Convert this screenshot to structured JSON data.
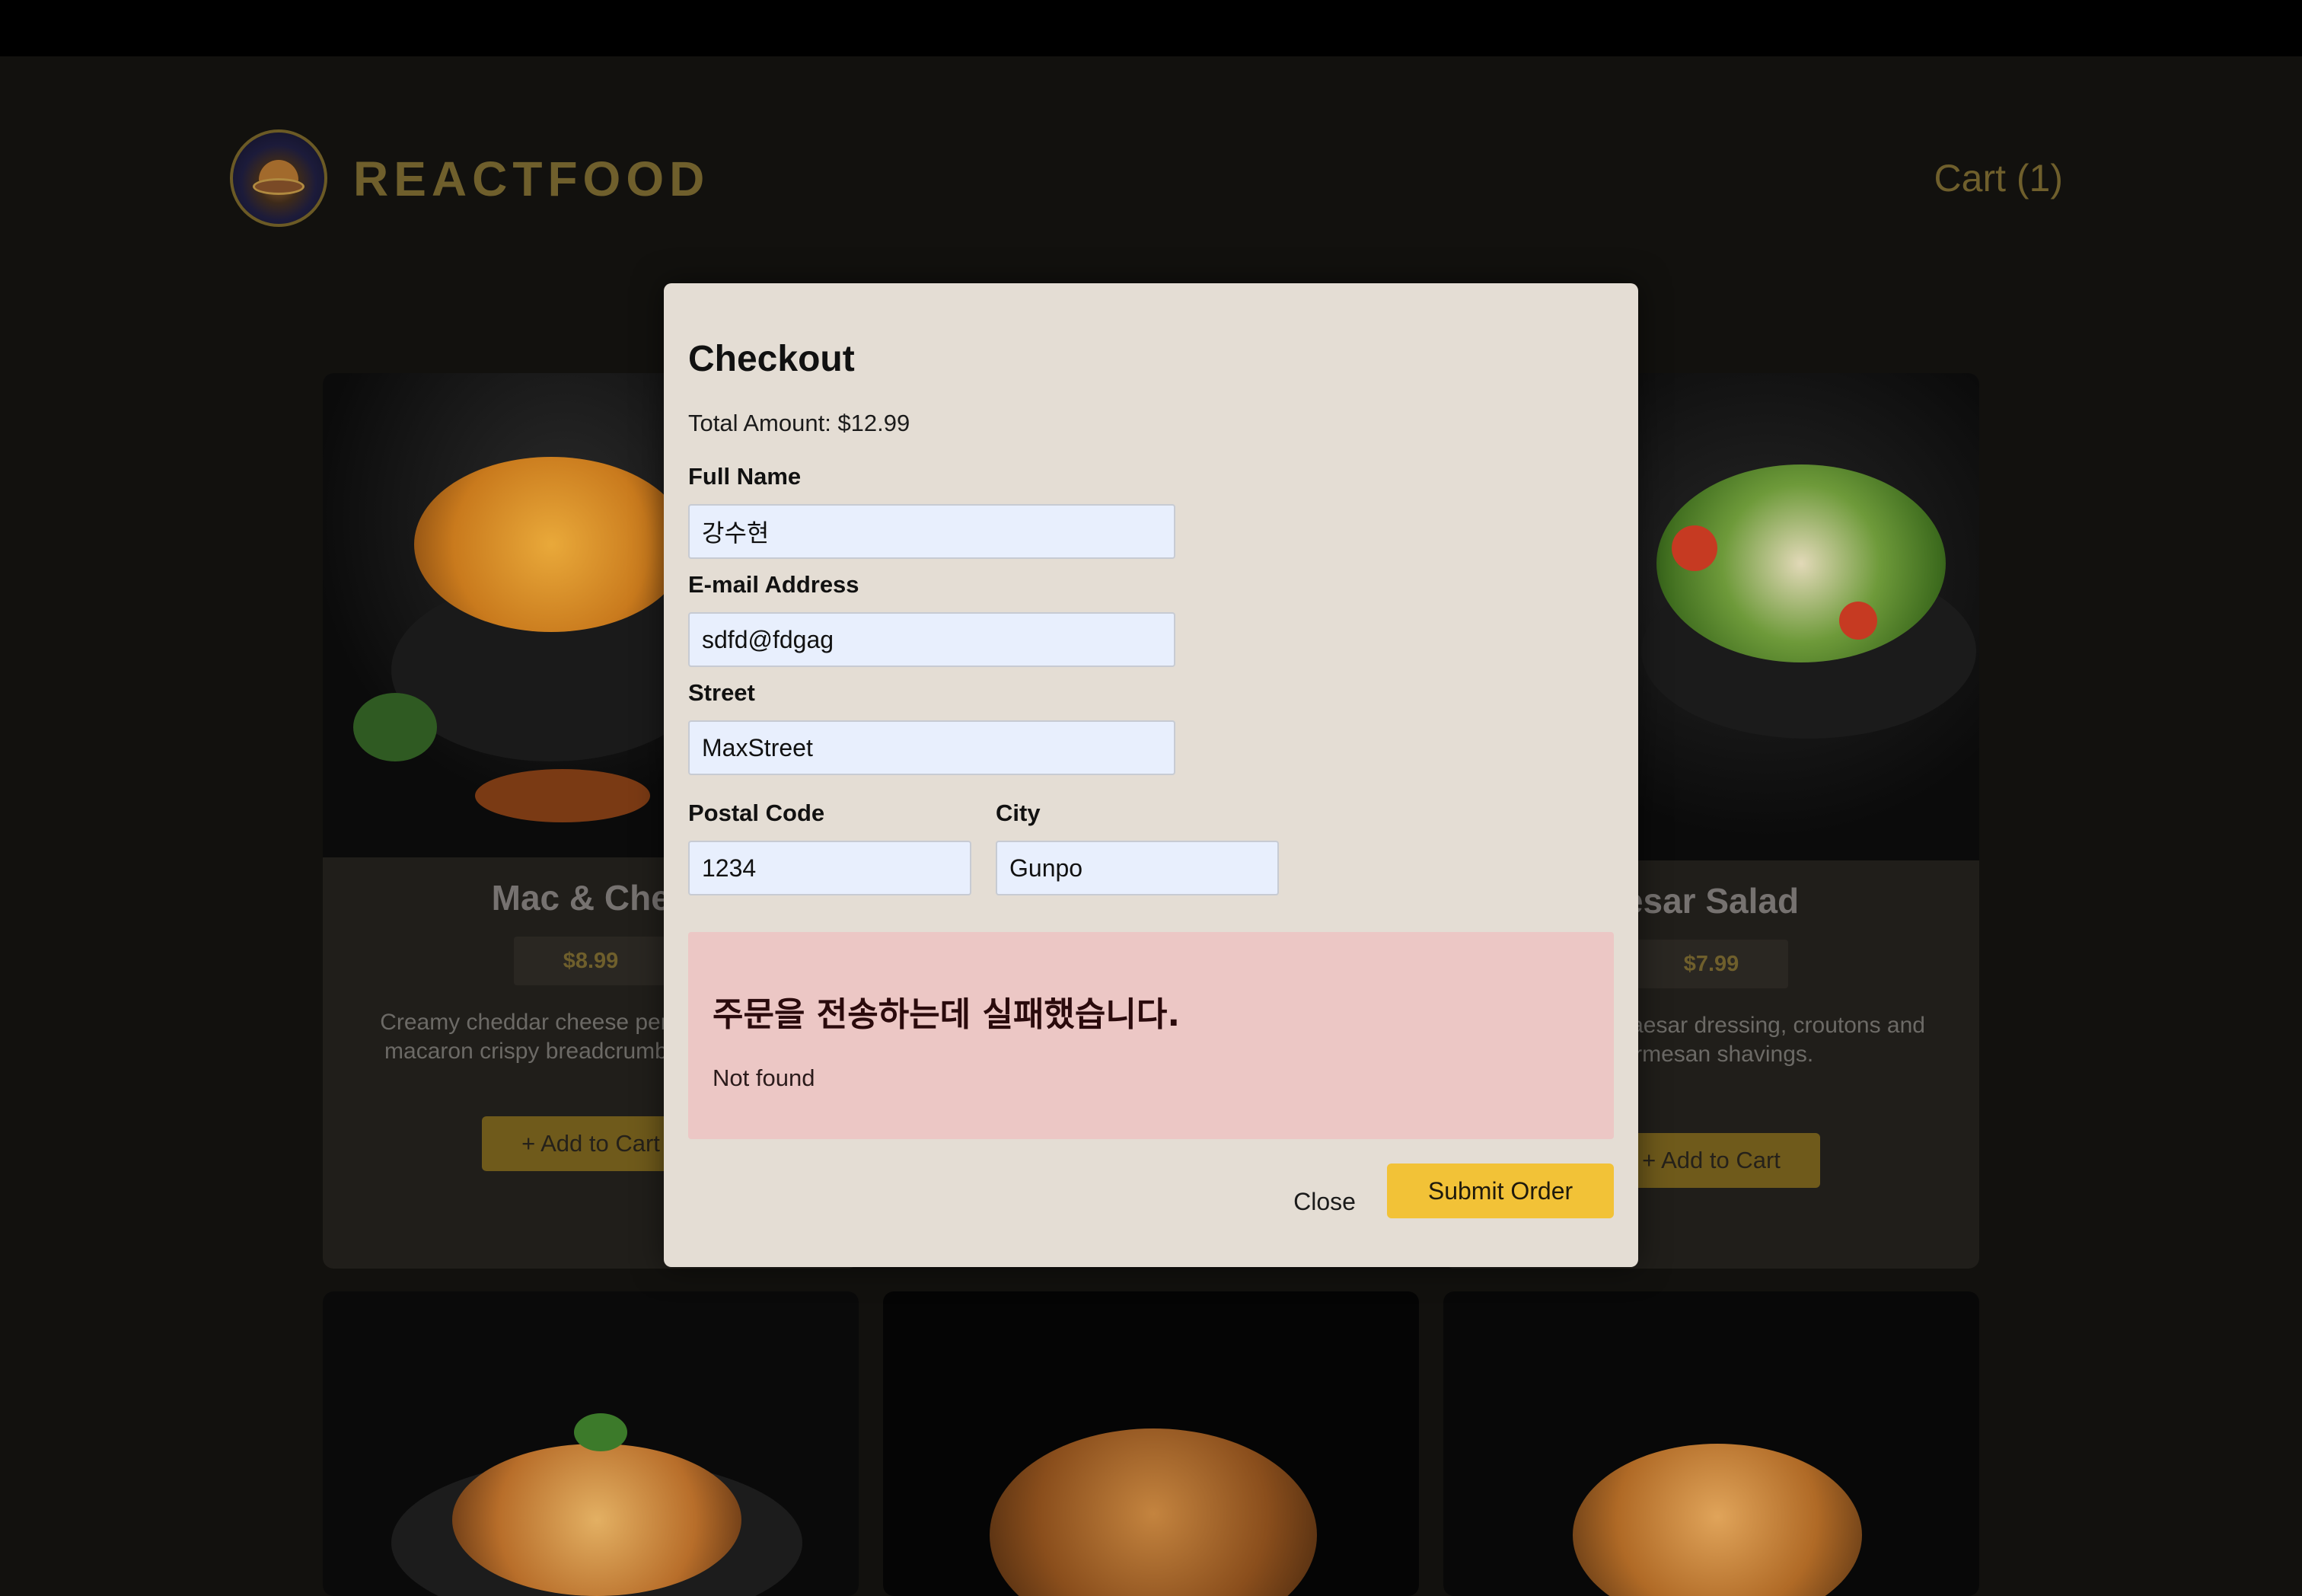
{
  "header": {
    "brand": "REACTFOOD",
    "cart_label": "Cart (1)"
  },
  "meals": [
    {
      "name": "Mac & Chee",
      "price": "$8.99",
      "description": "Creamy cheddar cheese perfectly cooked macaron crispy breadcrumbs. A cla food.",
      "add_label": "+ Add to Cart"
    },
    {
      "name": "esar Salad",
      "price": "$7.99",
      "description": "e tossed in Caesar dressing, croutons and parmesan shavings.",
      "add_label": "+ Add to Cart"
    }
  ],
  "checkout": {
    "title": "Checkout",
    "total": "Total Amount: $12.99",
    "fields": {
      "full_name": {
        "label": "Full Name",
        "value": "강수현"
      },
      "email": {
        "label": "E-mail Address",
        "value": "sdfd@fdgag"
      },
      "street": {
        "label": "Street",
        "value": "MaxStreet"
      },
      "postal": {
        "label": "Postal Code",
        "value": "1234"
      },
      "city": {
        "label": "City",
        "value": "Gunpo"
      }
    },
    "error": {
      "title": "주문을 전송하는데 실패했습니다.",
      "message": "Not found"
    },
    "close_label": "Close",
    "submit_label": "Submit Order"
  },
  "colors": {
    "accent": "#f2c237",
    "modal_bg": "#e4ddd4",
    "error_bg": "#ecc7c5",
    "input_bg": "#e8effd"
  }
}
